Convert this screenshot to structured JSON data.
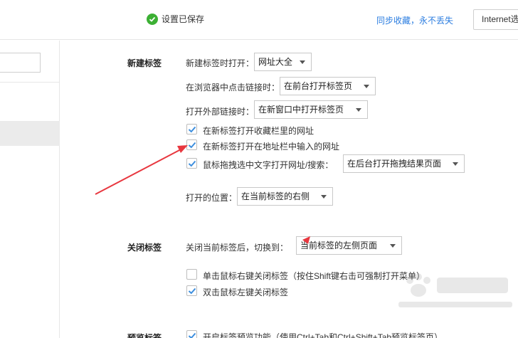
{
  "topbar": {
    "saved_text": "设置已保存",
    "sync_text": "同步收藏，永不丢失",
    "internet_button": "Internet选项"
  },
  "sections": {
    "new_tab": {
      "title": "新建标签",
      "open_label": "新建标签时打开：",
      "open_value": "网址大全",
      "click_link_label": "在浏览器中点击链接时：",
      "click_link_value": "在前台打开标签页",
      "external_label": "打开外部链接时：",
      "external_value": "在新窗口中打开标签页",
      "cb1": "在新标签打开收藏栏里的网址",
      "cb2": "在新标签打开在地址栏中输入的网址",
      "cb3": "鼠标拖拽选中文字打开网址/搜索：",
      "drag_value": "在后台打开拖拽结果页面",
      "position_label": "打开的位置：",
      "position_value": "在当前标签的右侧"
    },
    "close_tab": {
      "title": "关闭标签",
      "switch_label": "关闭当前标签后，切换到：",
      "switch_value": "当前标签的左侧页面",
      "cb1": "单击鼠标右键关闭标签（按住Shift键右击可强制打开菜单）",
      "cb2": "双击鼠标左键关闭标签"
    },
    "preview": {
      "title": "预览标签",
      "cb1": "开启标签预览功能（使用Ctrl+Tab和Ctrl+Shift+Tab预览标签页）"
    }
  },
  "colors": {
    "accent": "#2b7de0",
    "check": "#3c8ede",
    "annotation": "#e8373f",
    "saved_icon": "#3cb034"
  }
}
